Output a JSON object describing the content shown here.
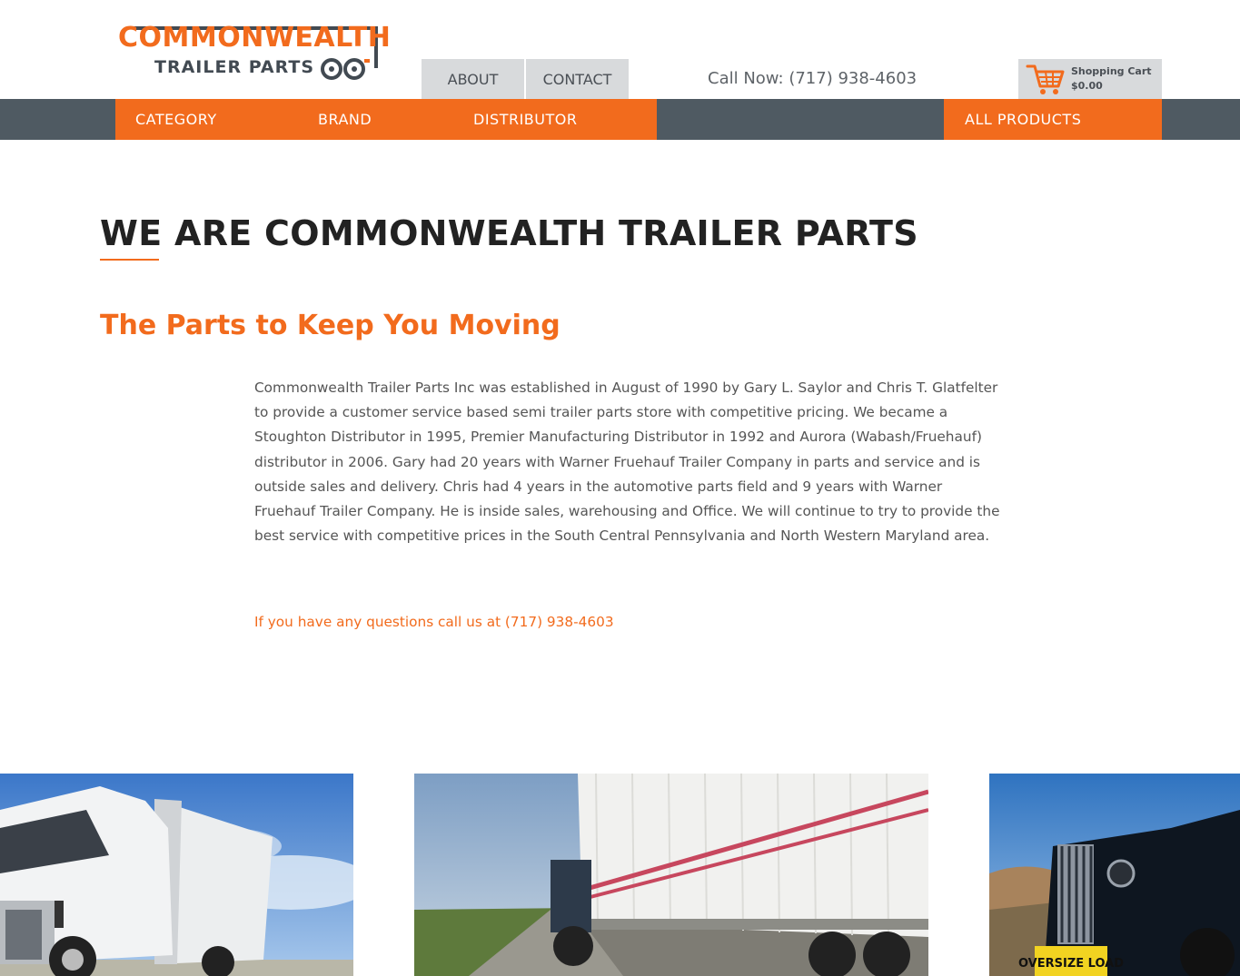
{
  "brand": {
    "logo_top": "COMMONWEALTH",
    "logo_bottom": "TRAILER PARTS",
    "accent_color": "#f26b1d",
    "dark_color": "#4f5a62"
  },
  "header": {
    "links": [
      {
        "label": "ABOUT"
      },
      {
        "label": "CONTACT"
      }
    ],
    "call_now": "Call Now: (717) 938-4603",
    "cart": {
      "icon": "shopping-cart-icon",
      "label": "Shopping Cart",
      "total": "$0.00"
    }
  },
  "nav": {
    "items": [
      {
        "label": "CATEGORY"
      },
      {
        "label": "BRAND"
      },
      {
        "label": "DISTRIBUTOR"
      }
    ],
    "all_products": "ALL PRODUCTS"
  },
  "main": {
    "title": "WE ARE COMMONWEALTH TRAILER PARTS",
    "subtitle": "The Parts to Keep You Moving",
    "body": "Commonwealth Trailer Parts Inc was established in August of 1990 by Gary L. Saylor and Chris T. Glatfelter to provide a customer service based semi trailer parts store with competitive pricing. We became a Stoughton Distributor in 1995, Premier Manufacturing Distributor in 1992 and Aurora (Wabash/Fruehauf) distributor in 2006. Gary had 20 years with Warner Fruehauf Trailer Company in parts and service and is outside sales and delivery. Chris had 4 years in the automotive parts field and 9 years with Warner Fruehauf Trailer Company. He is inside sales, warehousing and Office. We will continue to try to provide the best service with competitive prices in the South Central Pennsylvania and North Western Maryland area.",
    "cta": "If you have any questions call us at (717) 938-4603"
  },
  "photos": {
    "third_sign": "OVERSIZE LOAD"
  }
}
